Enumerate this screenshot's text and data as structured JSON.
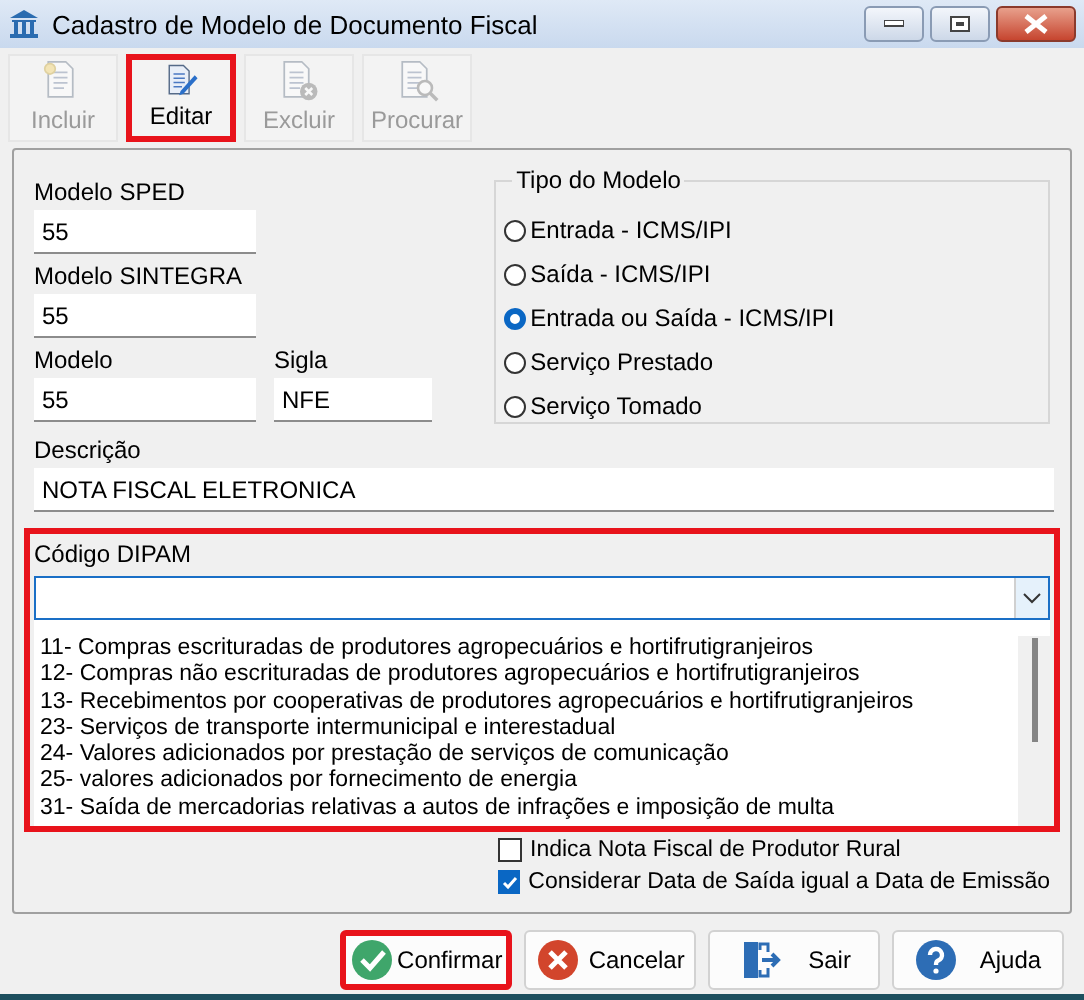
{
  "window": {
    "title": "Cadastro de Modelo de Documento Fiscal"
  },
  "toolbar": [
    {
      "kind": "add",
      "label": "Incluir",
      "disabled": true,
      "highlighted": false
    },
    {
      "kind": "edit",
      "label": "Editar",
      "disabled": false,
      "highlighted": true
    },
    {
      "kind": "delete",
      "label": "Excluir",
      "disabled": true,
      "highlighted": false
    },
    {
      "kind": "search",
      "label": "Procurar",
      "disabled": true,
      "highlighted": false
    }
  ],
  "fields": {
    "modelo_sped": {
      "label": "Modelo SPED",
      "value": "55"
    },
    "modelo_sintegra": {
      "label": "Modelo SINTEGRA",
      "value": "55"
    },
    "modelo": {
      "label": "Modelo",
      "value": "55"
    },
    "sigla": {
      "label": "Sigla",
      "value": "NFE"
    },
    "descricao": {
      "label": "Descrição",
      "value": "NOTA FISCAL ELETRONICA"
    }
  },
  "tipo_do_modelo": {
    "title": "Tipo do Modelo",
    "options": [
      {
        "label": "Entrada - ICMS/IPI",
        "selected": false
      },
      {
        "label": "Saída - ICMS/IPI",
        "selected": false
      },
      {
        "label": "Entrada ou Saída - ICMS/IPI",
        "selected": true
      },
      {
        "label": "Serviço Prestado",
        "selected": false
      },
      {
        "label": "Serviço Tomado",
        "selected": false
      }
    ]
  },
  "codigo_dipam": {
    "label": "Código DIPAM",
    "highlighted": true,
    "options": [
      "11- Compras escrituradas de produtores agropecuários e hortifrutigranjeiros",
      "12- Compras não escrituradas de produtores agropecuários e hortifrutigranjeiros",
      "13- Recebimentos por cooperativas de produtores agropecuários e hortifrutigranjeiros",
      "23- Serviços de transporte intermunicipal e interestadual",
      "24- Valores adicionados por prestação de serviços de comunicação",
      "25- valores adicionados por fornecimento de energia",
      "31- Saída de mercadorias relativas a autos de infrações e imposição de multa"
    ]
  },
  "checkboxes": [
    {
      "label": "Indica Nota Fiscal de Produtor Rural",
      "checked": false
    },
    {
      "label": "Considerar Data de Saída igual a Data de Emissão",
      "checked": true
    }
  ],
  "buttons": [
    {
      "kind": "confirm",
      "label": "Confirmar",
      "highlighted": true
    },
    {
      "kind": "cancel",
      "label": "Cancelar",
      "highlighted": false
    },
    {
      "kind": "exit",
      "label": "Sair",
      "highlighted": false
    },
    {
      "kind": "help",
      "label": "Ajuda",
      "highlighted": false
    }
  ]
}
